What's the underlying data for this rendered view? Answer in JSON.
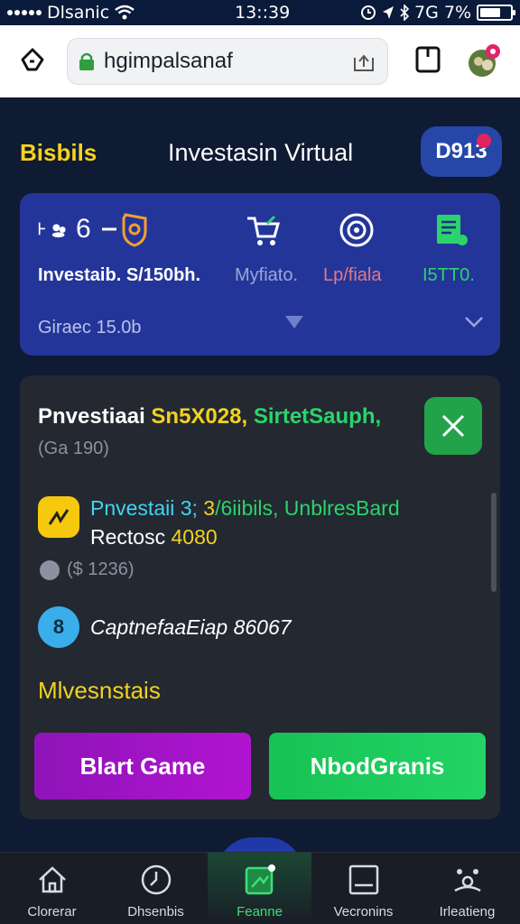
{
  "status_bar": {
    "carrier": "Dlsanic",
    "time": "13::39",
    "battery_text": "7G 7%",
    "battery_level_percent": 70
  },
  "browser": {
    "url": "hgimpalsanaf"
  },
  "header": {
    "brand": "Bisbils",
    "title": "Investasin Virtual",
    "pill": "D913"
  },
  "stats_card": {
    "count": "6",
    "main_label": "Investaib. S/150bh.",
    "columns": [
      {
        "icon": "cart-icon",
        "label": "Myfiato."
      },
      {
        "icon": "target-icon",
        "label": "Lp/fiala"
      },
      {
        "icon": "document-icon",
        "label": "I5TT0."
      }
    ],
    "balance": "Giraec 15.0b"
  },
  "panel": {
    "title_white": "Pnvestiaai",
    "title_yellow": "Sn5X028,",
    "title_green": "SirtetSauph,",
    "subtitle": "(Ga 190)",
    "row1": {
      "line1_cyan": "Pnvestaii 3;",
      "line1_yellow": "3",
      "line1_green": "/6iibils, UnblresBard",
      "line2_white": "Rectosc",
      "line2_yellow": "4080",
      "meta": "($ 1236)"
    },
    "row2": {
      "icon_text": "8",
      "text": "CaptnefaaEiap 86067"
    },
    "section_label": "Mlvesnstais",
    "primary_button": "Blart Game",
    "secondary_button": "NbodGranis"
  },
  "bottom_nav": {
    "items": [
      {
        "label": "Clorerar",
        "icon": "home-icon"
      },
      {
        "label": "Dhsenbis",
        "icon": "clock-icon"
      },
      {
        "label": "Feanne",
        "icon": "game-icon"
      },
      {
        "label": "Vecronins",
        "icon": "monitor-icon"
      },
      {
        "label": "Irleatieng",
        "icon": "settings-icon"
      }
    ],
    "active_index": 2
  },
  "colors": {
    "accent_yellow": "#f2d21f",
    "accent_green": "#2bd46a",
    "card_blue": "#24359a",
    "purple_button": "#a014c8"
  }
}
